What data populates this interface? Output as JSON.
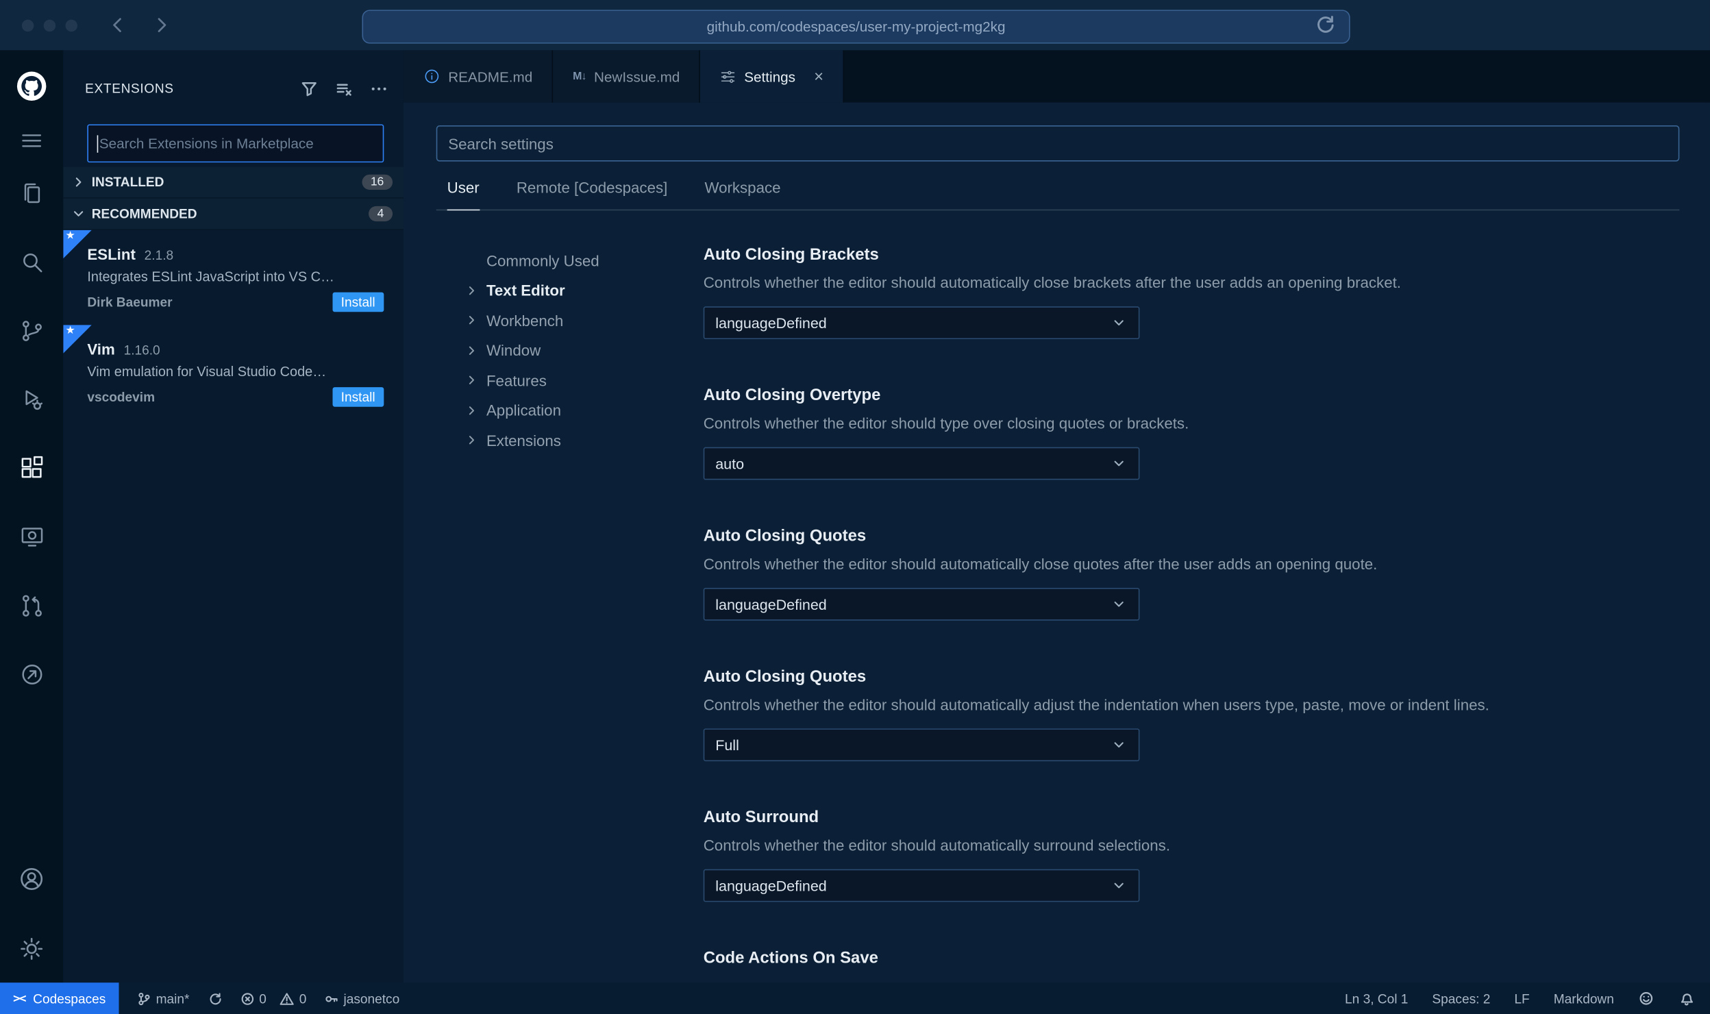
{
  "browser": {
    "url": "github.com/codespaces/user-my-project-mg2kg"
  },
  "sidebar": {
    "title": "EXTENSIONS",
    "search_placeholder": "Search Extensions in Marketplace",
    "sections": [
      {
        "label": "INSTALLED",
        "count": "16"
      },
      {
        "label": "RECOMMENDED",
        "count": "4"
      }
    ],
    "extensions": [
      {
        "name": "ESLint",
        "version": "2.1.8",
        "description": "Integrates ESLint JavaScript into VS C…",
        "author": "Dirk Baeumer",
        "action": "Install",
        "star": "★"
      },
      {
        "name": "Vim",
        "version": "1.16.0",
        "description": "Vim emulation for Visual Studio Code…",
        "author": "vscodevim",
        "action": "Install",
        "star": "★"
      }
    ]
  },
  "tabs": [
    {
      "label": "README.md"
    },
    {
      "label": "NewIssue.md",
      "icon_text": "M↓"
    },
    {
      "label": "Settings",
      "close": "×"
    }
  ],
  "settings": {
    "search_placeholder": "Search settings",
    "scopes": [
      {
        "label": "User"
      },
      {
        "label": "Remote [Codespaces]"
      },
      {
        "label": "Workspace"
      }
    ],
    "toc": [
      {
        "label": "Commonly Used"
      },
      {
        "label": "Text Editor"
      },
      {
        "label": "Workbench"
      },
      {
        "label": "Window"
      },
      {
        "label": "Features"
      },
      {
        "label": "Application"
      },
      {
        "label": "Extensions"
      }
    ],
    "items": [
      {
        "title": "Auto Closing Brackets",
        "description": "Controls whether the editor should automatically close brackets after the user adds an opening bracket.",
        "value": "languageDefined"
      },
      {
        "title": "Auto Closing Overtype",
        "description": "Controls whether the editor should type over closing quotes or brackets.",
        "value": "auto"
      },
      {
        "title": "Auto Closing Quotes",
        "description": "Controls whether the editor should automatically close quotes after the user adds an opening quote.",
        "value": "languageDefined"
      },
      {
        "title": "Auto Closing Quotes",
        "description": "Controls whether the editor should automatically adjust the indentation when users type, paste, move or indent lines.",
        "value": "Full"
      },
      {
        "title": "Auto Surround",
        "description": "Controls whether the editor should automatically surround selections.",
        "value": "languageDefined"
      },
      {
        "title": "Code Actions On Save"
      }
    ]
  },
  "status_bar": {
    "codespaces": "Codespaces",
    "branch": "main*",
    "errors": "0",
    "warnings": "0",
    "user": "jasonetco",
    "line_col": "Ln 3, Col 1",
    "spaces": "Spaces: 2",
    "eol": "LF",
    "language": "Markdown"
  },
  "colors": {
    "accent_blue": "#2f81f7",
    "install_blue": "#2f96f3",
    "statusbar_blue": "#1f6feb",
    "editor_bg": "#0b2036",
    "sidebar_bg": "#081a2e"
  }
}
